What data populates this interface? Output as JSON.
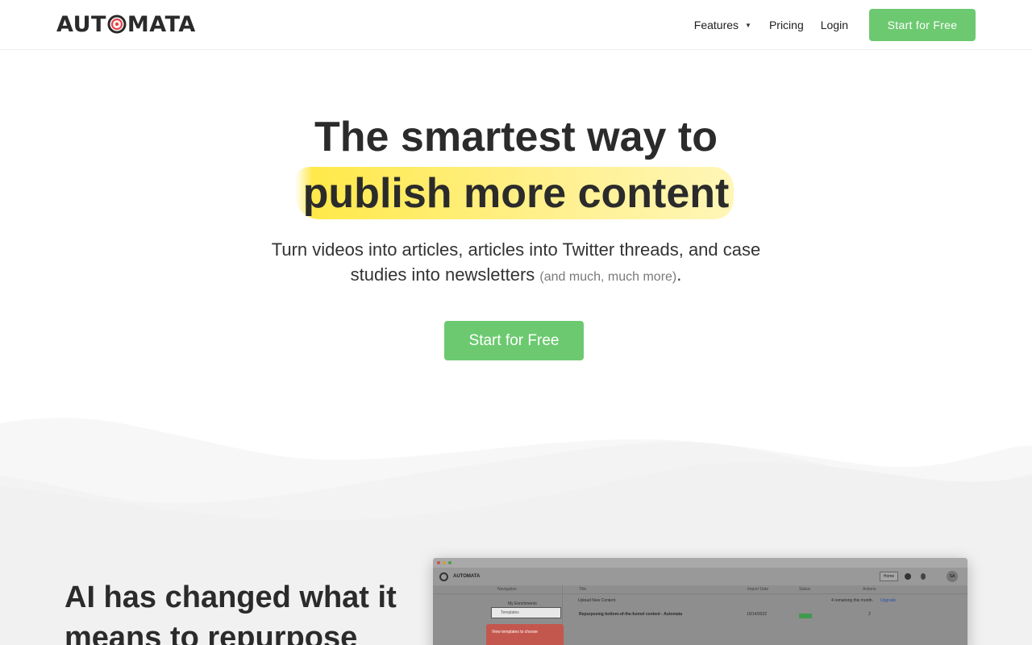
{
  "header": {
    "logo": {
      "left": "AUT",
      "right": "MATA"
    },
    "nav": {
      "features": "Features",
      "pricing": "Pricing",
      "login": "Login",
      "cta": "Start for Free"
    }
  },
  "hero": {
    "line1": "The smartest way to",
    "line2": "publish more content",
    "subtitle_main": "Turn videos into articles, articles into Twitter threads, and case studies into newsletters",
    "subtitle_muted": "(and much, much more)",
    "subtitle_end": ".",
    "cta": "Start for Free"
  },
  "section": {
    "title": "AI has changed what it means to repurpose"
  },
  "app_preview": {
    "brand": "AUTOMATA",
    "home_button": "Home",
    "avatar": "SA",
    "navigation_header": "Navigation",
    "nav_items": [
      "My Enrichments",
      "Templates"
    ],
    "columns": [
      "Title",
      "Import Date",
      "Status",
      "Actions"
    ],
    "upload_label": "Upload New Content",
    "remaining_text": "4 remaining this month.",
    "upgrade_link": "Upgrade.",
    "row": {
      "title": "Repurposing bottom-of-the-funnel content - Automata",
      "date": "10/14/2022",
      "actions": "2"
    },
    "tooltip": "View templates to choose"
  },
  "colors": {
    "accent_green": "#6cc970",
    "highlight_yellow": "#ffe94a",
    "logo_red": "#e8434a",
    "text_dark": "#2b2b2b"
  }
}
